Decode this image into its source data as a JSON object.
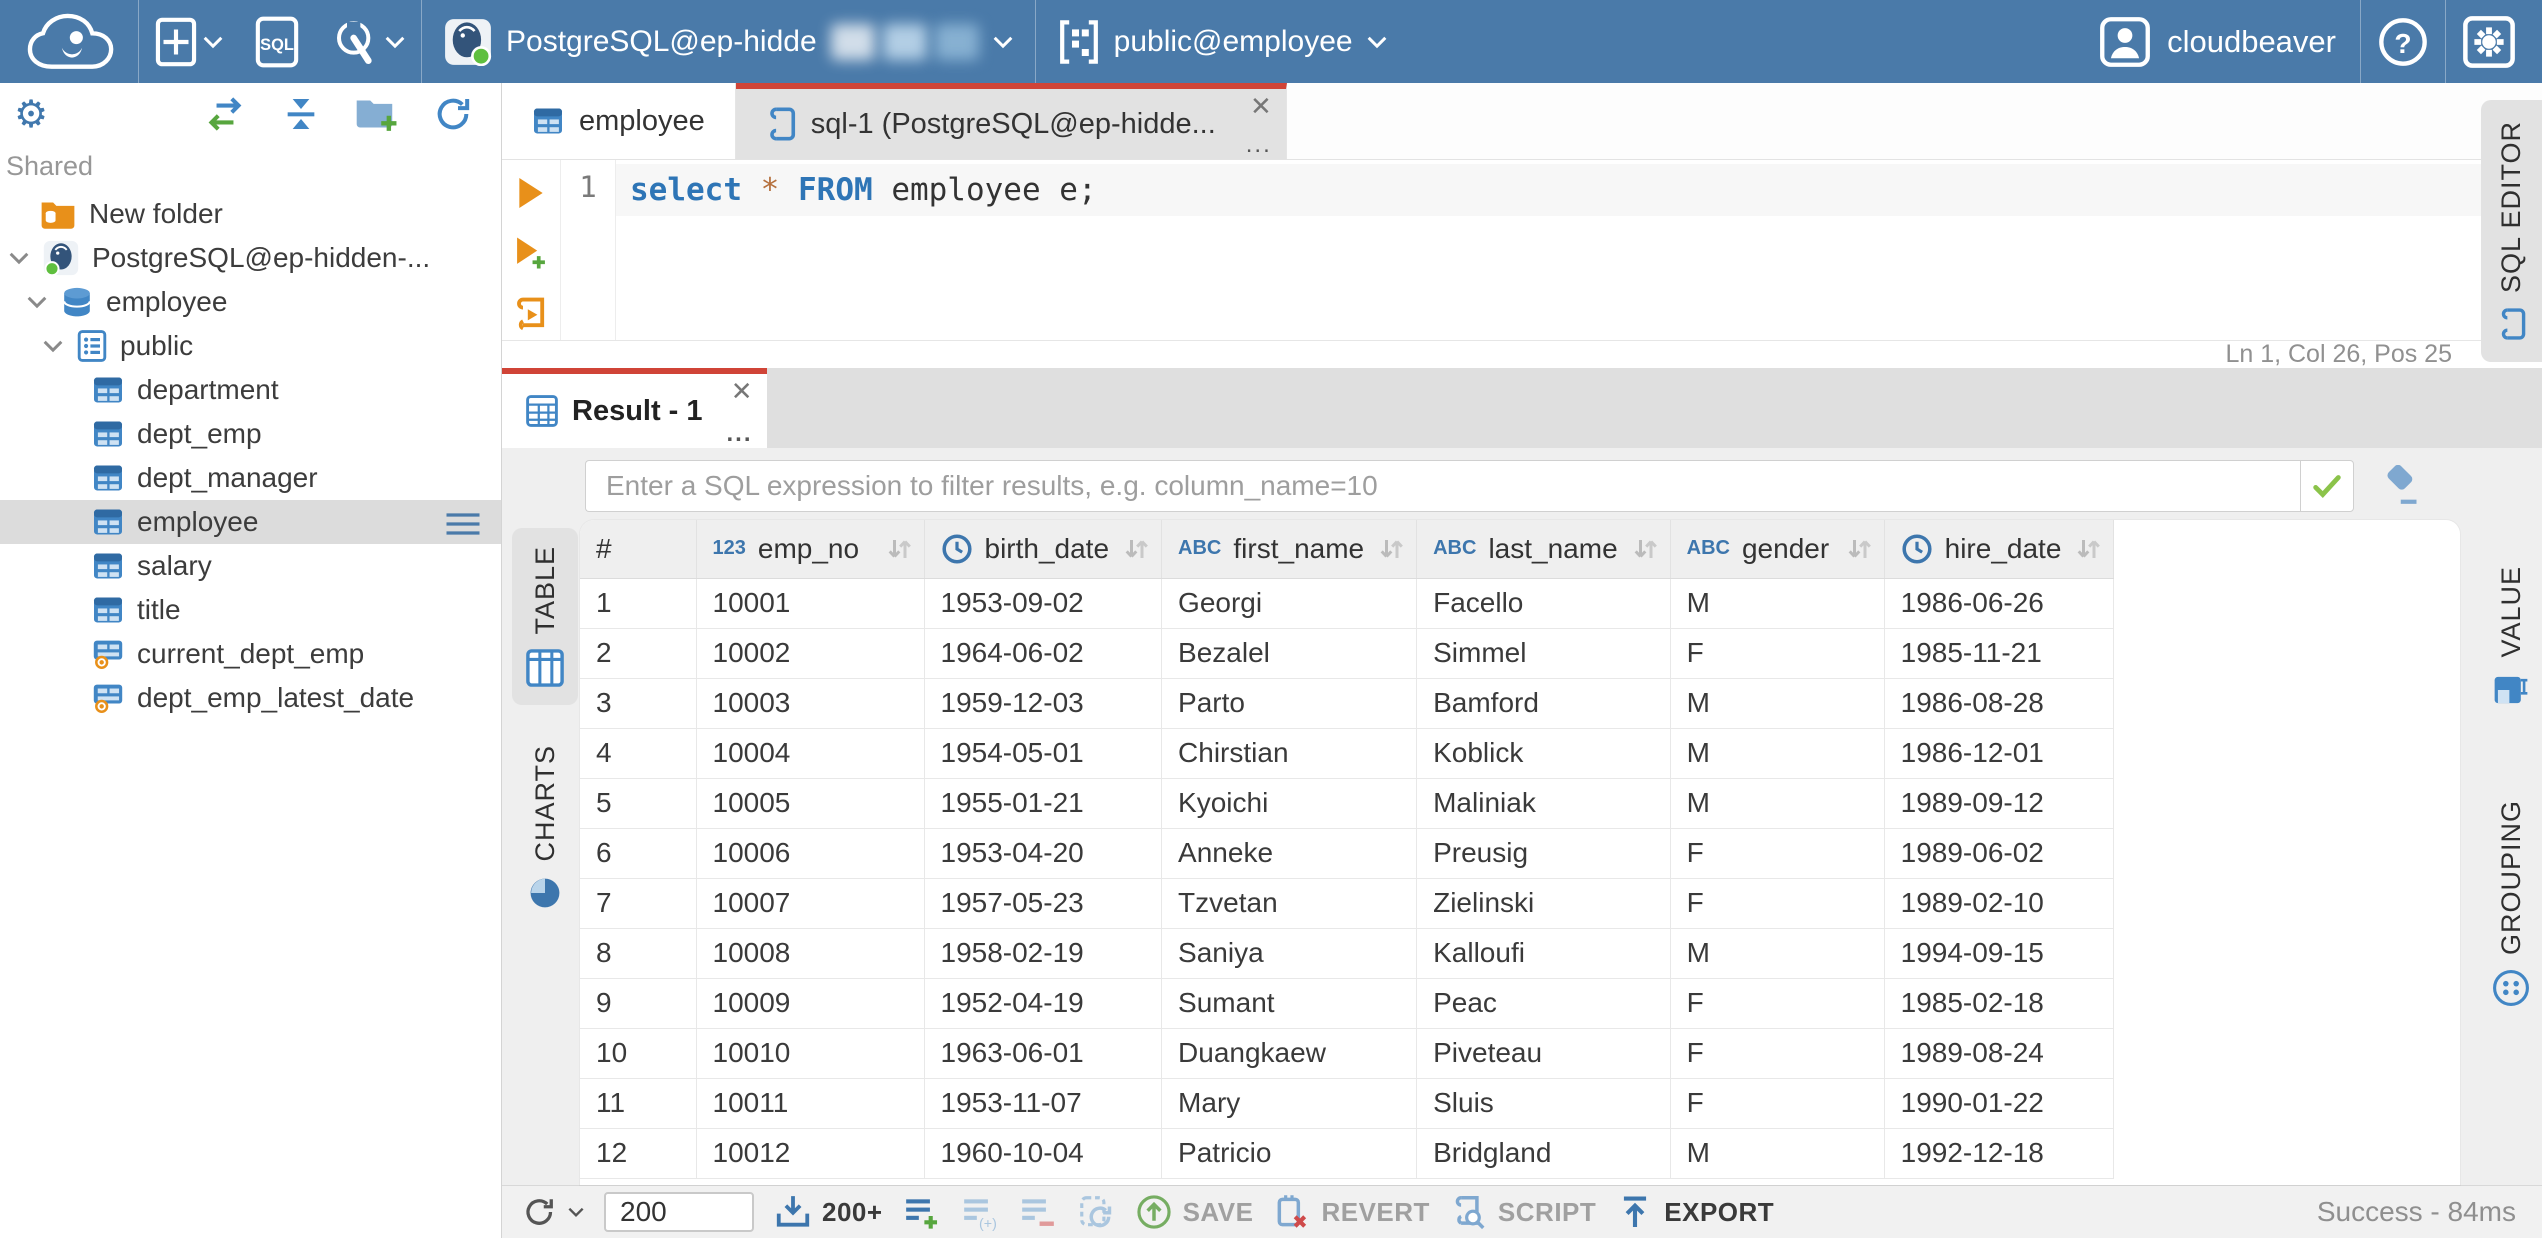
{
  "topbar": {
    "connection_name": "PostgreSQL@ep-hidde",
    "schema_selector": "public@employee",
    "username": "cloudbeaver"
  },
  "sidebar": {
    "section_label": "Shared",
    "tree": [
      {
        "label": "New folder",
        "icon": "folder-db",
        "level": 0,
        "expander": false
      },
      {
        "label": "PostgreSQL@ep-hidden-...",
        "icon": "postgres",
        "level": 0,
        "expander": true
      },
      {
        "label": "employee",
        "icon": "database",
        "level": 1,
        "expander": true
      },
      {
        "label": "public",
        "icon": "schema",
        "level": 2,
        "expander": true
      },
      {
        "label": "department",
        "icon": "table",
        "level": 3,
        "expander": false
      },
      {
        "label": "dept_emp",
        "icon": "table",
        "level": 3,
        "expander": false
      },
      {
        "label": "dept_manager",
        "icon": "table",
        "level": 3,
        "expander": false
      },
      {
        "label": "employee",
        "icon": "table",
        "level": 3,
        "expander": false,
        "selected": true,
        "menu": true
      },
      {
        "label": "salary",
        "icon": "table",
        "level": 3,
        "expander": false
      },
      {
        "label": "title",
        "icon": "table",
        "level": 3,
        "expander": false
      },
      {
        "label": "current_dept_emp",
        "icon": "view",
        "level": 3,
        "expander": false
      },
      {
        "label": "dept_emp_latest_date",
        "icon": "view",
        "level": 3,
        "expander": false
      }
    ]
  },
  "doc_tabs": [
    {
      "label": "employee",
      "active": false
    },
    {
      "label": "sql-1 (PostgreSQL@ep-hidde...",
      "active": true,
      "close": "✕",
      "more": "..."
    }
  ],
  "editor": {
    "line_number": "1",
    "code_tokens": [
      {
        "text": "select",
        "style": "keyword"
      },
      {
        "text": " ",
        "style": "plain"
      },
      {
        "text": "*",
        "style": "star"
      },
      {
        "text": " ",
        "style": "plain"
      },
      {
        "text": "FROM",
        "style": "keyword"
      },
      {
        "text": " employee e;",
        "style": "plain"
      }
    ],
    "caret_status": "Ln 1, Col 26, Pos 25",
    "right_tab": "SQL EDITOR"
  },
  "result_tabs": [
    {
      "label": "Result - 1",
      "active": true,
      "close": "✕",
      "more": "..."
    }
  ],
  "results": {
    "filter_placeholder": "Enter a SQL expression to filter results, e.g. column_name=10",
    "left_tabs": [
      {
        "label": "TABLE",
        "active": true
      },
      {
        "label": "CHARTS",
        "active": false
      }
    ],
    "right_tabs": [
      {
        "label": "VALUE"
      },
      {
        "label": "GROUPING"
      }
    ],
    "table": {
      "columns": [
        {
          "label": "#",
          "type": "rownum",
          "sortable": false
        },
        {
          "label": "emp_no",
          "type": "number",
          "sortable": true
        },
        {
          "label": "birth_date",
          "type": "datetime",
          "sortable": true
        },
        {
          "label": "first_name",
          "type": "string",
          "sortable": true
        },
        {
          "label": "last_name",
          "type": "string",
          "sortable": true
        },
        {
          "label": "gender",
          "type": "string",
          "sortable": true
        },
        {
          "label": "hire_date",
          "type": "datetime",
          "sortable": true
        }
      ],
      "rows": [
        [
          "1",
          "10001",
          "1953-09-02",
          "Georgi",
          "Facello",
          "M",
          "1986-06-26"
        ],
        [
          "2",
          "10002",
          "1964-06-02",
          "Bezalel",
          "Simmel",
          "F",
          "1985-11-21"
        ],
        [
          "3",
          "10003",
          "1959-12-03",
          "Parto",
          "Bamford",
          "M",
          "1986-08-28"
        ],
        [
          "4",
          "10004",
          "1954-05-01",
          "Chirstian",
          "Koblick",
          "M",
          "1986-12-01"
        ],
        [
          "5",
          "10005",
          "1955-01-21",
          "Kyoichi",
          "Maliniak",
          "M",
          "1989-09-12"
        ],
        [
          "6",
          "10006",
          "1953-04-20",
          "Anneke",
          "Preusig",
          "F",
          "1989-06-02"
        ],
        [
          "7",
          "10007",
          "1957-05-23",
          "Tzvetan",
          "Zielinski",
          "F",
          "1989-02-10"
        ],
        [
          "8",
          "10008",
          "1958-02-19",
          "Saniya",
          "Kalloufi",
          "M",
          "1994-09-15"
        ],
        [
          "9",
          "10009",
          "1952-04-19",
          "Sumant",
          "Peac",
          "F",
          "1985-02-18"
        ],
        [
          "10",
          "10010",
          "1963-06-01",
          "Duangkaew",
          "Piveteau",
          "F",
          "1989-08-24"
        ],
        [
          "11",
          "10011",
          "1953-11-07",
          "Mary",
          "Sluis",
          "F",
          "1990-01-22"
        ],
        [
          "12",
          "10012",
          "1960-10-04",
          "Patricio",
          "Bridgland",
          "M",
          "1992-12-18"
        ]
      ]
    }
  },
  "toolbar": {
    "row_limit_value": "200",
    "fetch_more_label": "200+",
    "save_label": "SAVE",
    "revert_label": "REVERT",
    "script_label": "SCRIPT",
    "export_label": "EXPORT",
    "status": "Success - 84ms"
  },
  "colors": {
    "topbar_blue": "#4a7aa9",
    "accent_red": "#d04437",
    "icon_blue": "#4186c5",
    "green": "#6fba44",
    "orange": "#e8901a"
  }
}
